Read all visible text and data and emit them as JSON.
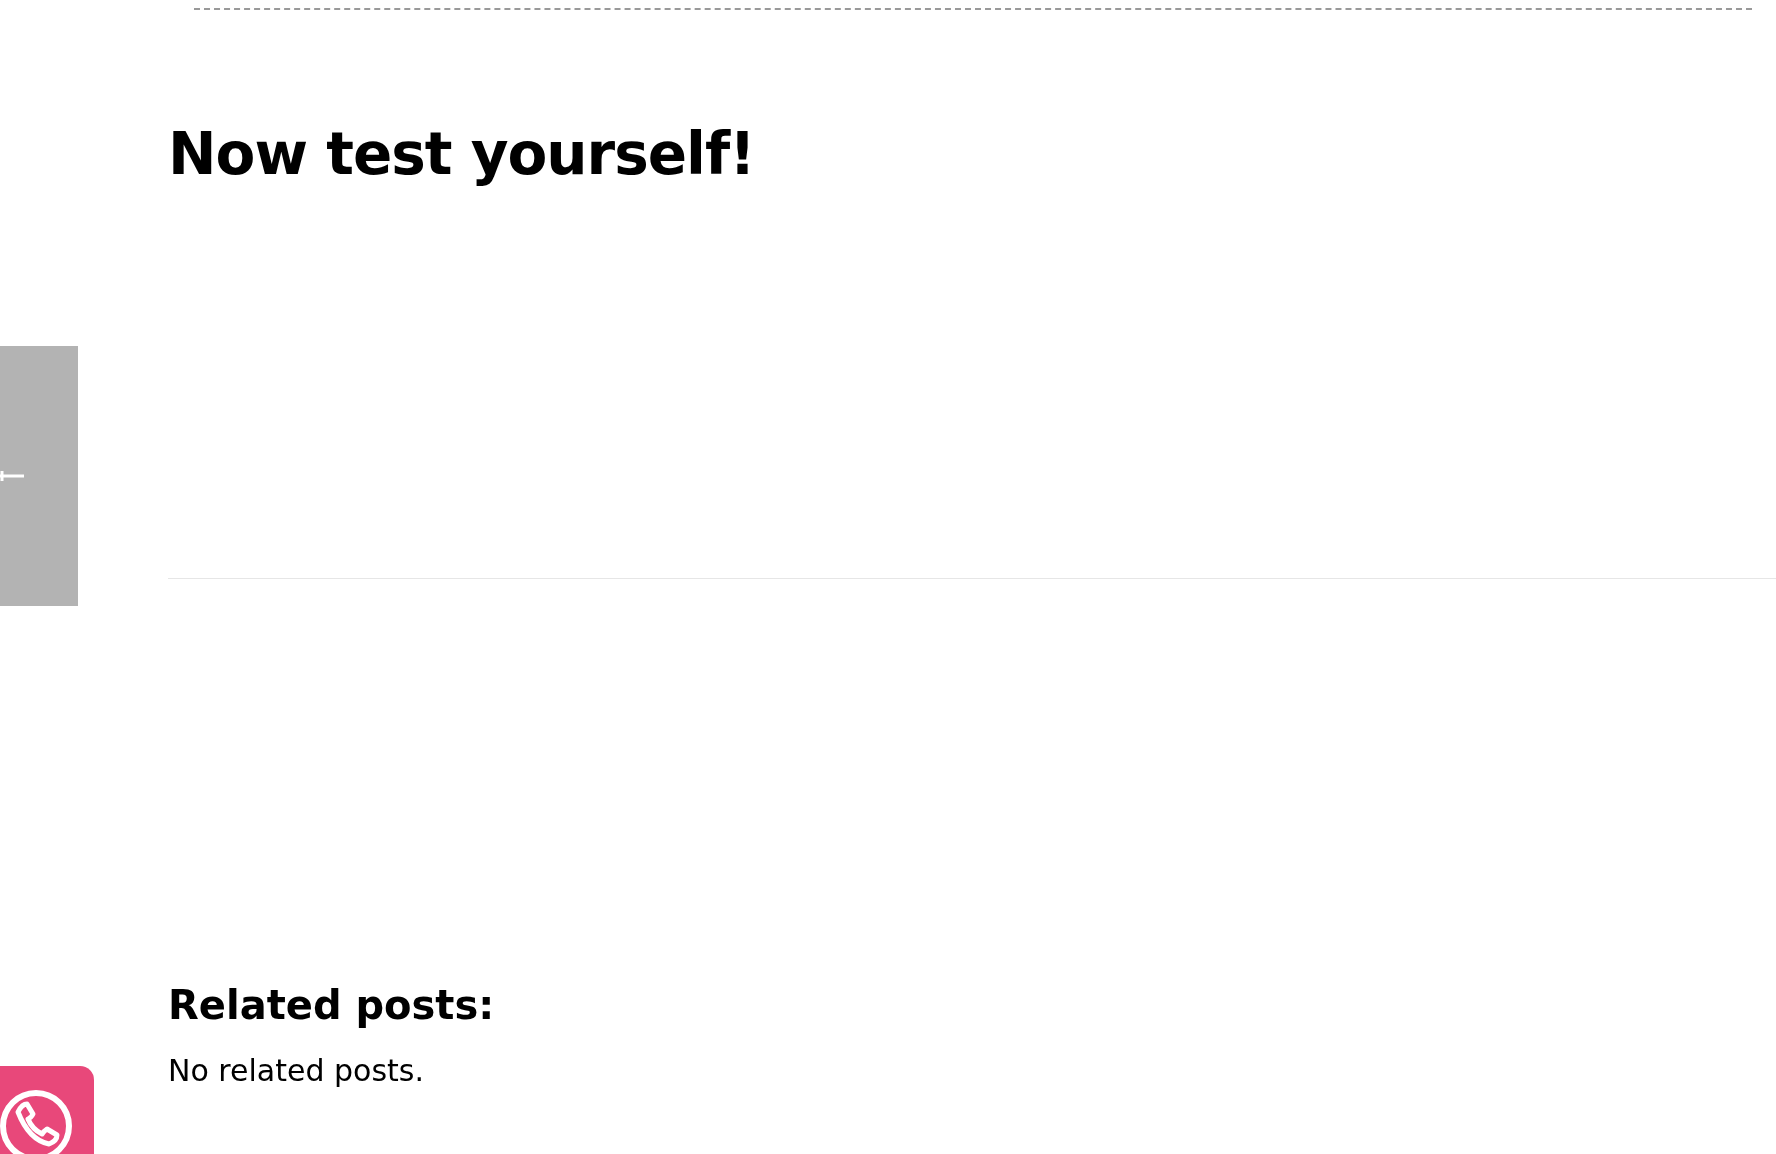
{
  "quiz": {
    "heading": "Now test yourself!"
  },
  "related_posts": {
    "heading": "Related posts:",
    "text": "No related posts."
  }
}
